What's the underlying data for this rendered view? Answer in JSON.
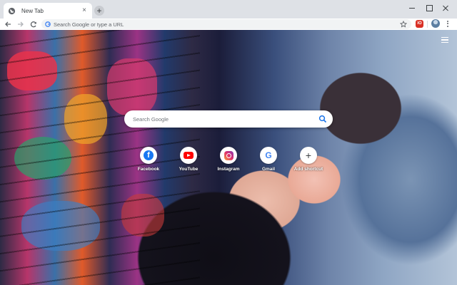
{
  "tab": {
    "title": "New Tab",
    "close_glyph": "×"
  },
  "new_tab_glyph": "+",
  "omnibox": {
    "placeholder": "Search Google or type a URL"
  },
  "extension": {
    "label": "iO"
  },
  "search": {
    "placeholder": "Search Google"
  },
  "shortcuts": [
    {
      "label": "Facebook",
      "icon": "facebook-icon",
      "glyph": "f"
    },
    {
      "label": "YouTube",
      "icon": "youtube-icon"
    },
    {
      "label": "Instagram",
      "icon": "instagram-icon"
    },
    {
      "label": "Gmail",
      "icon": "google-icon",
      "glyph": "G"
    },
    {
      "label": "Add shortcut",
      "icon": "plus-icon",
      "glyph": "+"
    }
  ],
  "colors": {
    "chrome_frame": "#dee1e6",
    "omnibox_bg": "#f1f3f4",
    "accent": "#1a73e8"
  }
}
